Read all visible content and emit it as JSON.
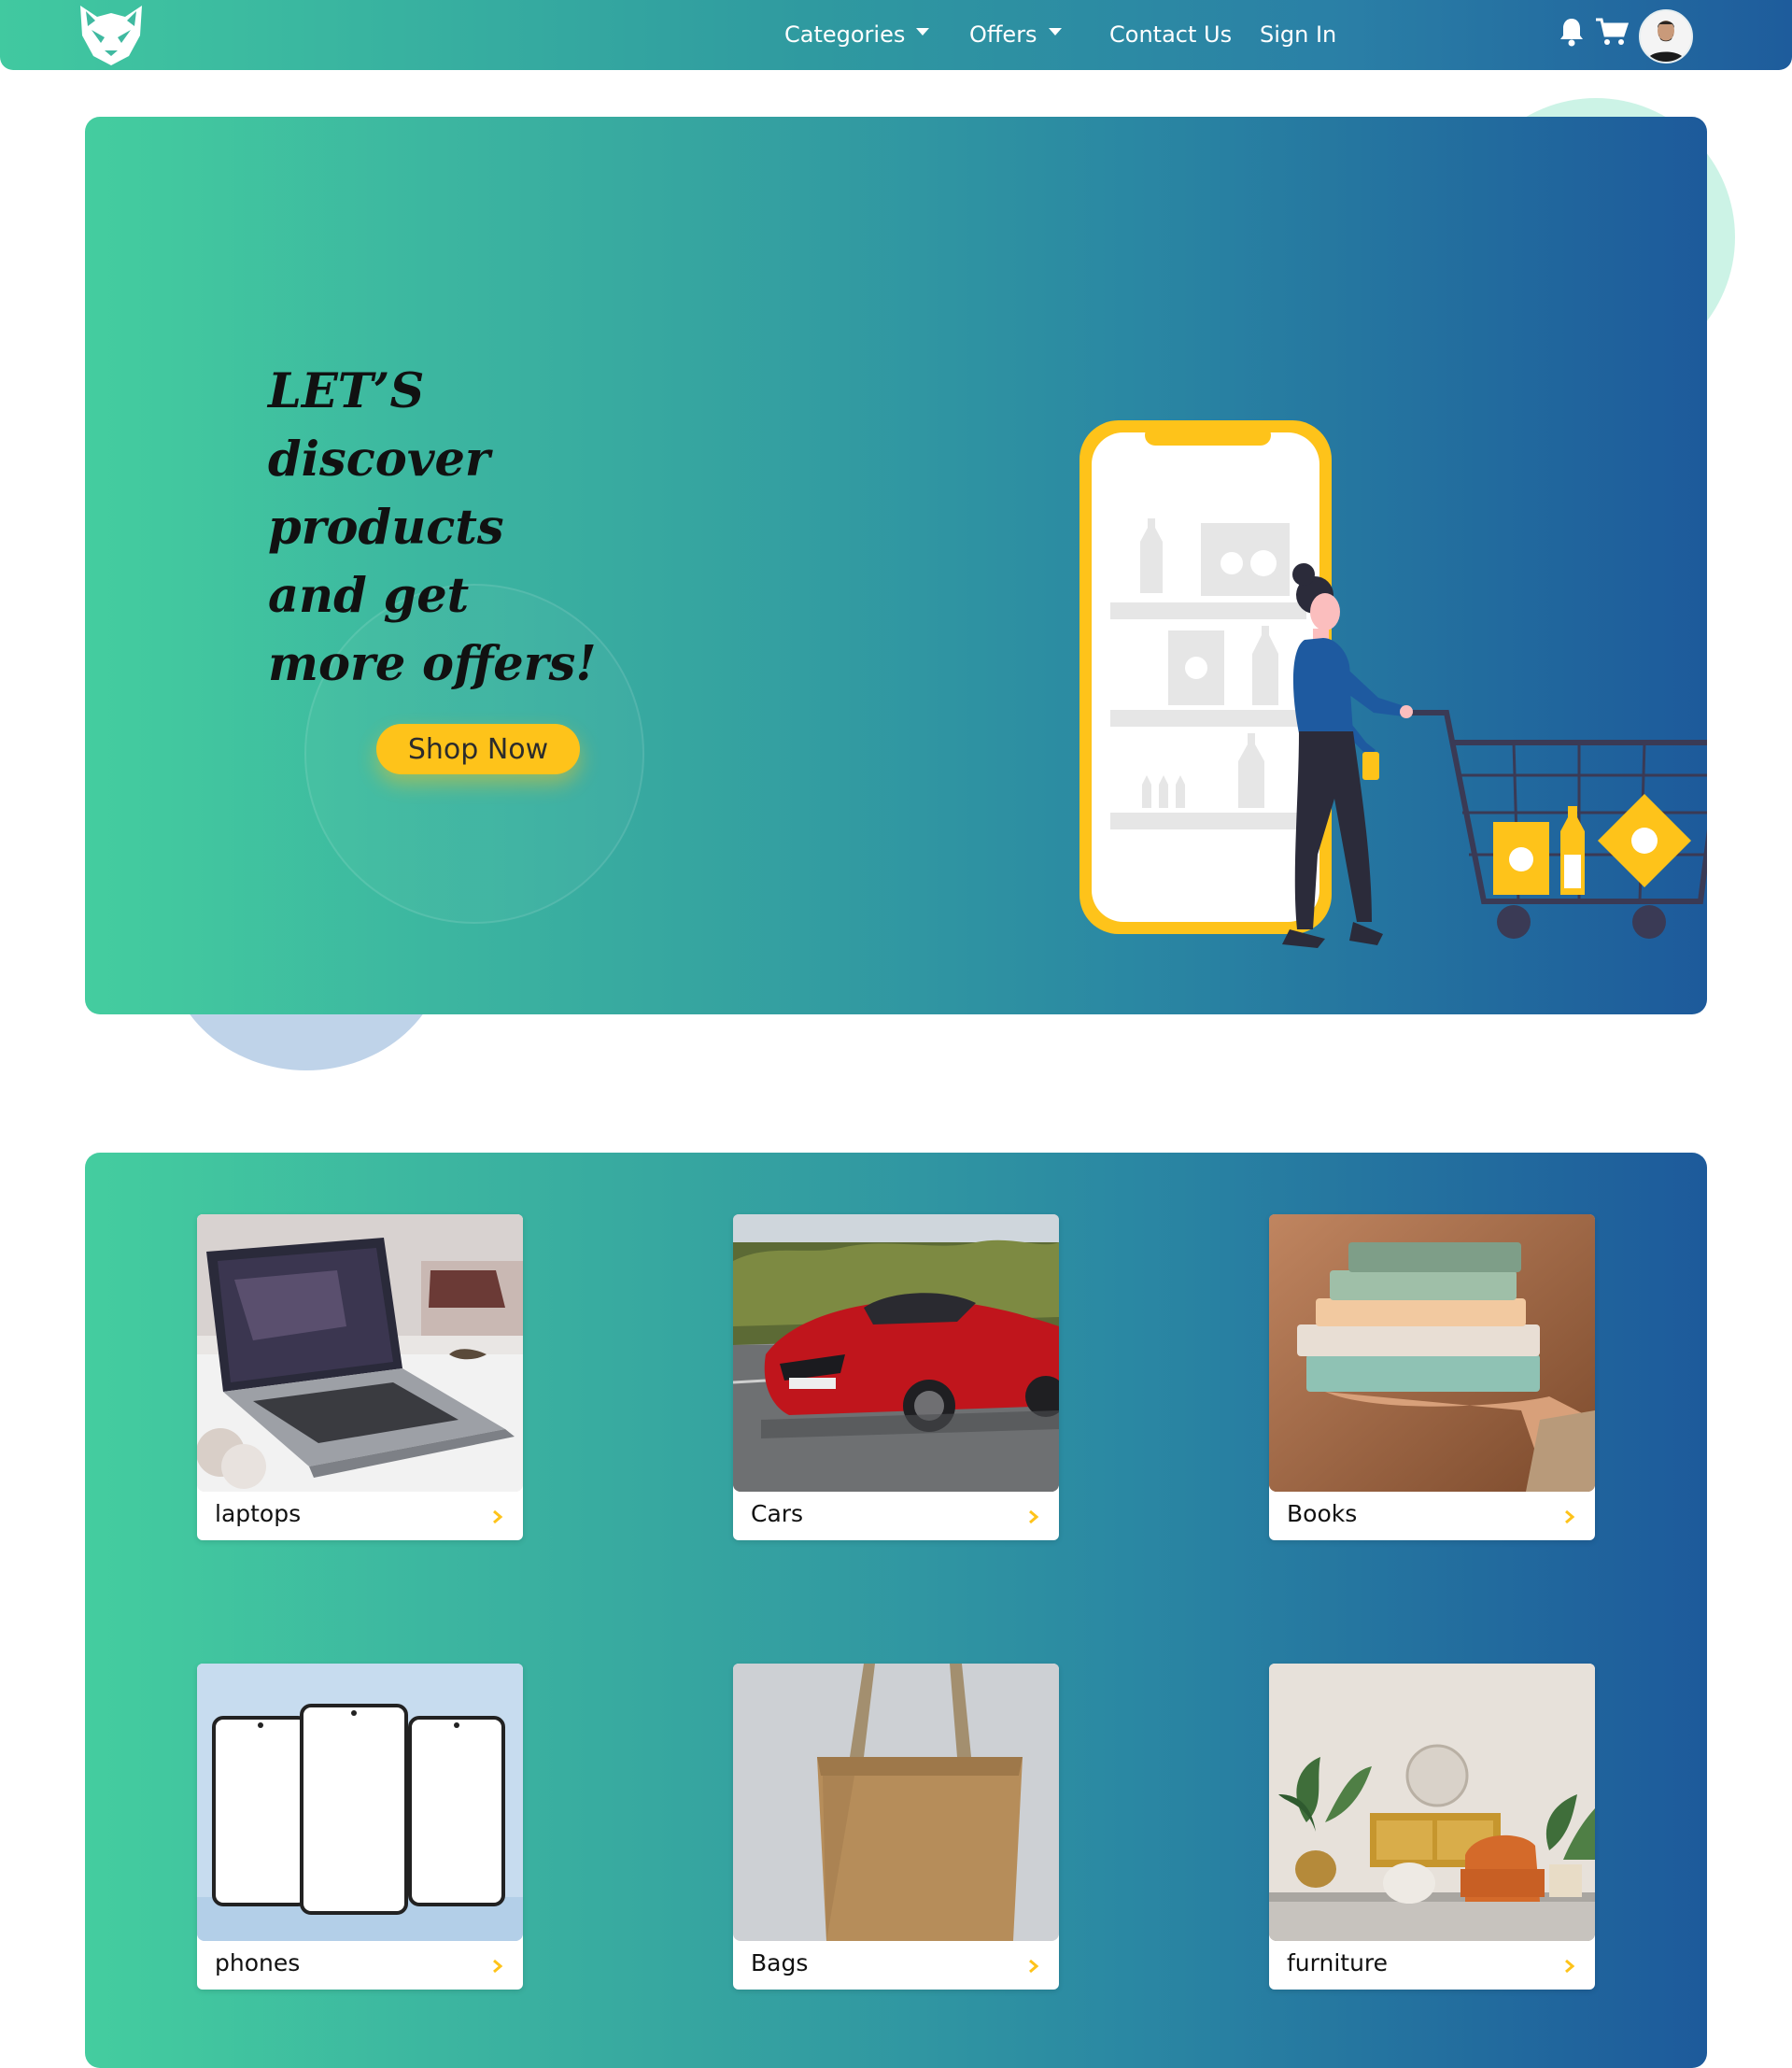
{
  "navbar": {
    "logo_icon": "fox-logo-icon",
    "links": [
      {
        "label": "Categories",
        "dropdown": true
      },
      {
        "label": "Offers",
        "dropdown": true
      },
      {
        "label": "Contact Us",
        "dropdown": false
      },
      {
        "label": "Sign In",
        "dropdown": false
      }
    ],
    "icons": [
      "bell-icon",
      "cart-icon"
    ],
    "avatar": "user-avatar"
  },
  "hero": {
    "title_lines": [
      "LET’S",
      "discover",
      "products",
      "and get",
      "more offers!"
    ],
    "button_label": "Shop Now",
    "illustration": "woman-shopping-cart-phone-illustration"
  },
  "categories": [
    {
      "label": "laptops",
      "image": "laptop-photo"
    },
    {
      "label": "Cars",
      "image": "red-car-photo"
    },
    {
      "label": "Books",
      "image": "books-stack-photo"
    },
    {
      "label": "phones",
      "image": "phones-photo"
    },
    {
      "label": "Bags",
      "image": "tote-bag-photo"
    },
    {
      "label": "furniture",
      "image": "living-room-photo"
    }
  ],
  "colors": {
    "gradient_start": "#44cd9f",
    "gradient_end": "#1d5a9b",
    "accent_yellow": "#fec31a",
    "navbar_text": "#ffffff"
  }
}
